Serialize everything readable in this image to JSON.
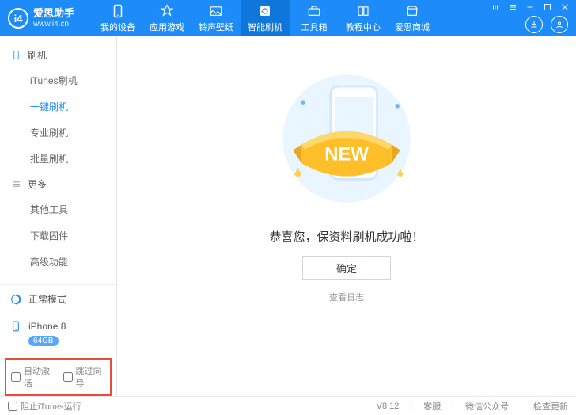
{
  "brand": {
    "name": "爱思助手",
    "domain": "www.i4.cn"
  },
  "nav": {
    "items": [
      "我的设备",
      "应用游戏",
      "铃声壁纸",
      "智能刷机",
      "工具箱",
      "教程中心",
      "爱思商城"
    ],
    "active_index": 3
  },
  "sidebar": {
    "group1": {
      "label": "刷机"
    },
    "tree1": [
      "iTunes刷机",
      "一键刷机",
      "专业刷机",
      "批量刷机"
    ],
    "tree1_active_index": 1,
    "group2": {
      "label": "更多"
    },
    "tree2": [
      "其他工具",
      "下载固件",
      "高级功能"
    ],
    "mode": "正常模式",
    "device": "iPhone 8",
    "storage": "64GB",
    "opt_auto_activate": "自动激活",
    "opt_skip_guide": "跳过向导"
  },
  "main": {
    "ribbon_text": "NEW",
    "message": "恭喜您，保资料刷机成功啦！",
    "ok": "确定",
    "log": "查看日志"
  },
  "statusbar": {
    "block_itunes": "阻止iTunes运行",
    "version": "V8.12",
    "s1": "客服",
    "s2": "微信公众号",
    "s3": "检查更新"
  }
}
